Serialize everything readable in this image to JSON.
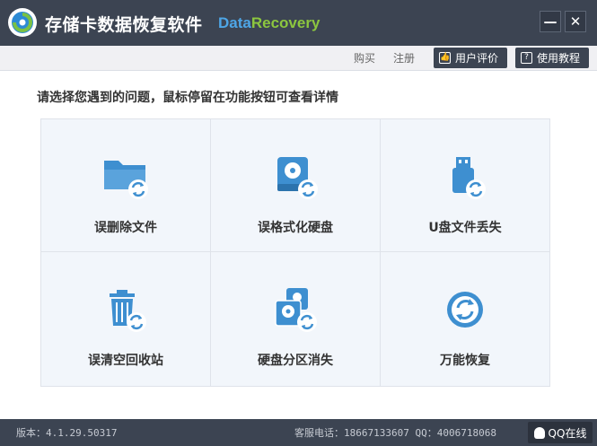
{
  "app": {
    "title": "存储卡数据恢复软件",
    "brand_part1": "Data",
    "brand_part2": "Recovery",
    "minimize_label": "—",
    "close_label": "✕"
  },
  "topnav": {
    "buy": "购买",
    "register": "注册",
    "user_review": "用户评价",
    "tutorial": "使用教程"
  },
  "main": {
    "prompt": "请选择您遇到的问题，鼠标停留在功能按钮可查看详情",
    "options": [
      {
        "label": "误删除文件",
        "icon": "folder-restore-icon"
      },
      {
        "label": "误格式化硬盘",
        "icon": "harddisk-restore-icon"
      },
      {
        "label": "U盘文件丢失",
        "icon": "usb-restore-icon"
      },
      {
        "label": "误清空回收站",
        "icon": "recycle-bin-restore-icon"
      },
      {
        "label": "硬盘分区消失",
        "icon": "partition-restore-icon"
      },
      {
        "label": "万能恢复",
        "icon": "universal-restore-icon"
      }
    ]
  },
  "status": {
    "version": "版本：4.1.29.50317",
    "contact": "客服电话：18667133607 QQ：4006718068",
    "qq_online": "QQ在线"
  },
  "colors": {
    "titlebar": "#3c4452",
    "icon_blue": "#3e8fd0",
    "brand_blue": "#4ea6e6",
    "brand_green": "#8cc63f"
  }
}
